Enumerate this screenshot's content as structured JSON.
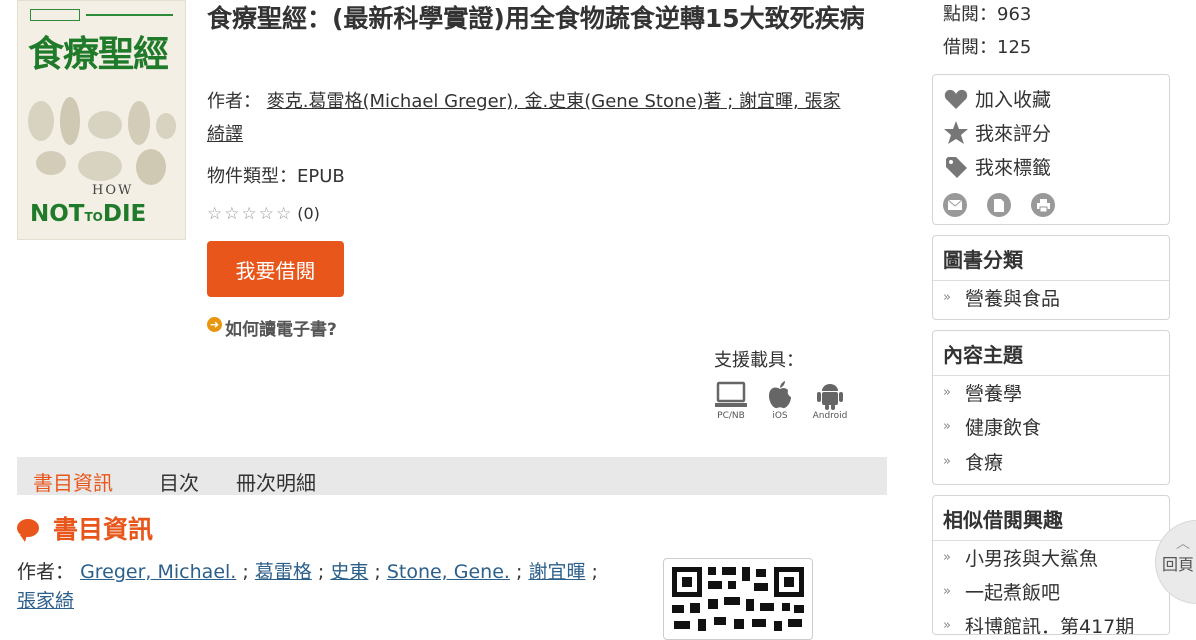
{
  "book": {
    "title": "食療聖經：(最新科學實證)用全食物蔬食逆轉15大致死疾病",
    "cover": {
      "title": "食療聖經",
      "how": "HOW",
      "not": "NOT",
      "to": "TO",
      "die": "DIE"
    },
    "author_label": "作者：",
    "author_text": "麥克.葛雷格(Michael Greger), 金.史東(Gene Stone)著 ; 謝宜暉, 張家綺譯",
    "type_label": "物件類型：",
    "type_value": "EPUB",
    "rating_stars": "☆☆☆☆☆",
    "rating_count": "(0)",
    "borrow_button": "我要借閱",
    "howto_link": "如何讀電子書?",
    "support_label": "支援載具：",
    "devices": [
      {
        "label": "PC/NB",
        "icon": "laptop-icon"
      },
      {
        "label": "iOS",
        "icon": "apple-icon"
      },
      {
        "label": "Android",
        "icon": "android-icon"
      }
    ]
  },
  "tabs": [
    {
      "label": "書目資訊",
      "active": true
    },
    {
      "label": "目次",
      "active": false
    },
    {
      "label": "冊次明細",
      "active": false
    }
  ],
  "section": {
    "title": "書目資訊",
    "author_label": "作者：",
    "authors": [
      "Greger, Michael.",
      "葛雷格",
      "史東",
      "Stone, Gene.",
      "謝宜暉",
      "張家綺"
    ],
    "separator": " ; "
  },
  "sidebar": {
    "views_label": "點閱：963",
    "borrows_label": "借閱：125",
    "actions": [
      {
        "label": "加入收藏",
        "icon": "heart-icon"
      },
      {
        "label": "我來評分",
        "icon": "star-icon"
      },
      {
        "label": "我來標籤",
        "icon": "tag-icon"
      }
    ],
    "share_icons": [
      "mail-icon",
      "document-icon",
      "print-icon"
    ],
    "category": {
      "title": "圖書分類",
      "items": [
        "營養與食品"
      ]
    },
    "subjects": {
      "title": "內容主題",
      "items": [
        "營養學",
        "健康飲食",
        "食療"
      ]
    },
    "similar": {
      "title": "相似借閱興趣",
      "items": [
        "小男孩與大鯊魚",
        "一起煮飯吧",
        "科博館訊．第417期"
      ]
    }
  },
  "back_to_top": "回頁",
  "colors": {
    "accent": "#e8561b",
    "tab_bg": "#e8e8e8",
    "link": "#2c5f8a"
  }
}
